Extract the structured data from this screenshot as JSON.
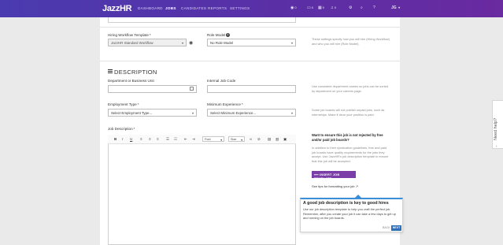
{
  "nav": {
    "logo": "JazzHR",
    "items": [
      "DASHBOARD",
      "JOBS",
      "CANDIDATES",
      "REPORTS",
      "SETTINGS"
    ],
    "active": "JOBS",
    "counters": [
      {
        "icon": "eye-icon",
        "value": "0"
      },
      {
        "icon": "chat-icon",
        "value": "0"
      },
      {
        "icon": "calendar-icon",
        "value": "0"
      },
      {
        "icon": "bell-icon",
        "value": "0"
      }
    ],
    "user_initials": "JG"
  },
  "workflow": {
    "hiring_label": "Hiring Workflow Template",
    "hiring_value": "JazzHR Standard Workflow",
    "role_label": "Role Model",
    "role_value": "No Role Model",
    "help": "These settings specify how you will hire (Hiring Workflow) and who you will hire (Role Model)."
  },
  "description": {
    "title": "DESCRIPTION",
    "department_label": "Department or Business Unit",
    "internal_id_label": "Internal Job Code",
    "dept_help": "Use consistent department names so jobs can be sorted by department on your careers page.",
    "employment_label": "Employment Type",
    "employment_value": "Select Employment Type...",
    "experience_label": "Minimum Experience",
    "experience_value": "Select Minimum Experience...",
    "employment_help": "Some job boards will not publish unpaid jobs, such as internships. Make it clear your position is paid.",
    "job_desc_label": "Job Description",
    "font_select": "Font",
    "size_select": "Size"
  },
  "sidebar_help": {
    "question": "Want to ensure this job is not rejected by free and/or paid job boards?",
    "body": "In addition to their syndication guidelines, free and paid job boards have quality requirements for the jobs they accept. Use JazzHR's job description template to ensure that this job will be accepted.",
    "insert_button": "INSERT JOB TEMPLATE",
    "tips_link": "See tips for formatting your job"
  },
  "popup": {
    "title": "A good job description is key to good hires",
    "body": "Use our job description template to help you craft the perfect job. Remember, after you create your job it can take a few days to get up and running on the job boards.",
    "back": "BACK",
    "next": "NEXT"
  },
  "help_tab": {
    "label": "Need help?"
  },
  "colors": {
    "nav_start": "#4a3bb0",
    "nav_end": "#6a2aa0",
    "accent": "#7b3ea8",
    "link_blue": "#2f6fb8"
  }
}
